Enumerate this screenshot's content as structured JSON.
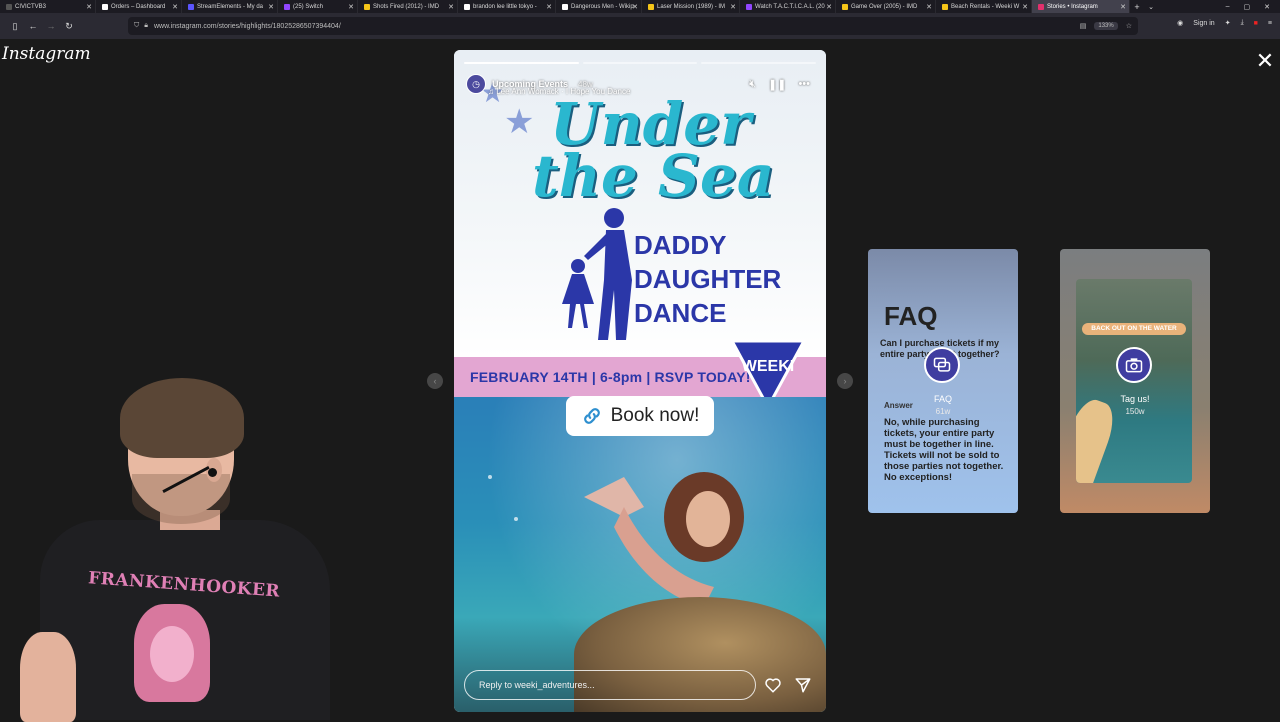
{
  "browser": {
    "tabs": [
      {
        "label": "CIVICTVB3",
        "color": "#555555",
        "active": false
      },
      {
        "label": "Orders – Dashboard",
        "color": "#ffffff",
        "active": false
      },
      {
        "label": "StreamElements - My da",
        "color": "#5b55ff",
        "active": false
      },
      {
        "label": "(25) Switch",
        "color": "#9146ff",
        "active": false
      },
      {
        "label": "Shots Fired (2012) - IMD",
        "color": "#f5c518",
        "active": false
      },
      {
        "label": "brandon lee little tokyo -",
        "color": "#ffffff",
        "active": false
      },
      {
        "label": "Dangerous Men - Wikip",
        "color": "#ffffff",
        "active": false
      },
      {
        "label": "Laser Mission (1989) - IM",
        "color": "#f5c518",
        "active": false
      },
      {
        "label": "Watch T.A.C.T.I.C.A.L. (20",
        "color": "#9146ff",
        "active": false
      },
      {
        "label": "Game Over (2005) - IMD",
        "color": "#f5c518",
        "active": false
      },
      {
        "label": "Beach Rentals - Weeki W",
        "color": "#f5c518",
        "active": false
      },
      {
        "label": "Stories • Instagram",
        "color": "#e1306c",
        "active": true
      }
    ],
    "new_tab": "+",
    "tab_list": "⌄",
    "window_controls": [
      "–",
      "▢",
      "✕"
    ],
    "url": "www.instagram.com/stories/highlights/18025286507394404/",
    "zoom": "133%",
    "sign_in": "Sign in"
  },
  "page": {
    "logo": "Instagram",
    "close": "✕"
  },
  "story": {
    "account": "Upcoming Events",
    "time": "48w",
    "music": "Lee Ann Womack · I Hope You Dance",
    "title_line1": "Under",
    "title_line2": "the Sea",
    "dance_line1": "DADDY",
    "dance_line2": "DAUGHTER",
    "dance_line3": "DANCE",
    "date_band": "FEBRUARY 14TH | 6-8pm | RSVP TODAY!",
    "badge": "WEEKI",
    "book_label": "Book now!",
    "reply_placeholder": "Reply to weeki_adventures...",
    "progress_segments": 3,
    "progress_done": 1
  },
  "cards": {
    "faq": {
      "title": "FAQ",
      "question": "Can I purchase tickets if my entire party is not together?",
      "answer_label": "Answer",
      "answer": "No, while purchasing tickets, your entire party must be together in line. Tickets will not be sold to those parties not together. No exceptions!",
      "highlight_name": "FAQ",
      "highlight_time": "61w"
    },
    "tag": {
      "banner": "BACK OUT ON THE WATER",
      "highlight_name": "Tag us!",
      "highlight_time": "150w"
    }
  },
  "streamer": {
    "shirt_text": "FRANKENHOOKER"
  }
}
